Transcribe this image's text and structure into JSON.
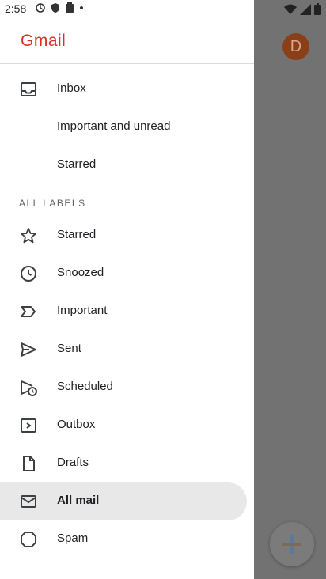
{
  "status_bar": {
    "time": "2:58"
  },
  "drawer": {
    "logo": "Gmail",
    "primary_items": [
      {
        "label": "Inbox",
        "icon": "inbox-icon"
      },
      {
        "label": "Important and unread",
        "icon": ""
      },
      {
        "label": "Starred",
        "icon": ""
      }
    ],
    "all_labels_header": "ALL LABELS",
    "label_items": [
      {
        "label": "Starred",
        "icon": "star-icon"
      },
      {
        "label": "Snoozed",
        "icon": "clock-icon"
      },
      {
        "label": "Important",
        "icon": "important-icon"
      },
      {
        "label": "Sent",
        "icon": "send-icon"
      },
      {
        "label": "Scheduled",
        "icon": "scheduled-send-icon"
      },
      {
        "label": "Outbox",
        "icon": "outbox-icon"
      },
      {
        "label": "Drafts",
        "icon": "draft-icon"
      },
      {
        "label": "All mail",
        "icon": "all-mail-icon",
        "selected": true
      },
      {
        "label": "Spam",
        "icon": "spam-icon"
      }
    ]
  },
  "background": {
    "avatar_letter": "D"
  },
  "colors": {
    "brand_red": "#d93025",
    "selected_bg": "#e8e8e8",
    "scrim": "#6d6d6d"
  }
}
